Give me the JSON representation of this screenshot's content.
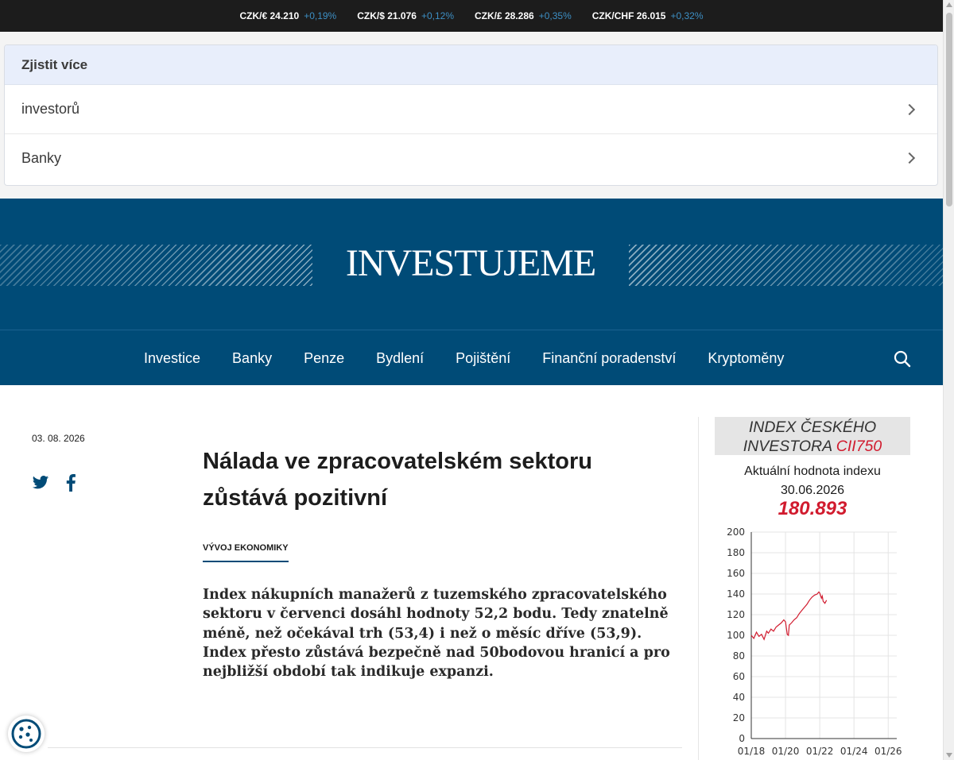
{
  "ticker": [
    {
      "label": "CZK/€ 24.210",
      "change": "+0,19%"
    },
    {
      "label": "CZK/$ 21.076",
      "change": "+0,12%"
    },
    {
      "label": "CZK/£ 28.286",
      "change": "+0,35%"
    },
    {
      "label": "CZK/CHF 26.015",
      "change": "+0,32%"
    }
  ],
  "learn_more": {
    "title": "Zjistit více",
    "items": [
      "investorů",
      "Banky"
    ]
  },
  "brand": "INVESTUJEME",
  "nav": {
    "items": [
      "Investice",
      "Banky",
      "Penze",
      "Bydlení",
      "Pojištění",
      "Finanční poradenství",
      "Kryptoměny"
    ],
    "search_icon": "search-icon"
  },
  "article": {
    "date": "03. 08. 2026",
    "headline": "Nálada ve zpracovatelském sektoru zůstává pozitivní",
    "category": "VÝVOJ EKONOMIKY",
    "perex": "Index nákupních manažerů z tuzemského zpracovatelského sektoru v červenci dosáhl hodnoty 52,2 bodu. Tedy znatelně méně, než očekával trh (53,4) i než o měsíc dříve (53,9). Index přesto zůstává bezpečně nad 50bodovou hranicí a pro nejbližší období tak indikuje expanzi.",
    "share_icons": [
      "twitter-icon",
      "facebook-icon"
    ]
  },
  "index_widget": {
    "title_line1": "INDEX ČESKÉHO",
    "title_line2": "INVESTORA",
    "title_highlight": "CII750",
    "subtitle_line1": "Aktuální hodnota indexu",
    "subtitle_line2": "30.06.2026",
    "value": "180.893",
    "accent_color": "#d11b2e"
  },
  "chart_data": {
    "type": "line",
    "title": "",
    "xlabel": "",
    "ylabel": "",
    "ylim": [
      0,
      200
    ],
    "yticks": [
      0,
      20,
      40,
      60,
      80,
      100,
      120,
      140,
      160,
      180,
      200
    ],
    "xticks": [
      "01/18",
      "01/20",
      "01/22",
      "01/24",
      "01/26"
    ],
    "xlim": [
      2018.0,
      2026.5
    ],
    "grid": true,
    "series": [
      {
        "color": "#d11b2e",
        "x": [
          2018.0,
          2018.15,
          2018.3,
          2018.45,
          2018.6,
          2018.75,
          2018.9,
          2019.0,
          2019.15,
          2019.3,
          2019.45,
          2019.6,
          2019.75,
          2019.9,
          2020.0,
          2020.1,
          2020.17,
          2020.22,
          2020.35,
          2020.5,
          2020.65,
          2020.8,
          2020.95,
          2021.1,
          2021.25,
          2021.4,
          2021.55,
          2021.7,
          2021.85,
          2021.95,
          2022.0,
          2022.1,
          2022.15,
          2022.2,
          2022.3,
          2022.4
        ],
        "y": [
          100,
          97,
          103,
          99,
          101,
          96,
          104,
          102,
          106,
          104,
          108,
          110,
          112,
          115,
          113,
          101,
          100,
          110,
          112,
          115,
          117,
          121,
          124,
          127,
          130,
          134,
          137,
          139,
          140,
          142,
          141,
          136,
          138,
          133,
          131,
          134
        ]
      }
    ]
  },
  "cookie_icon": "cookie-icon"
}
